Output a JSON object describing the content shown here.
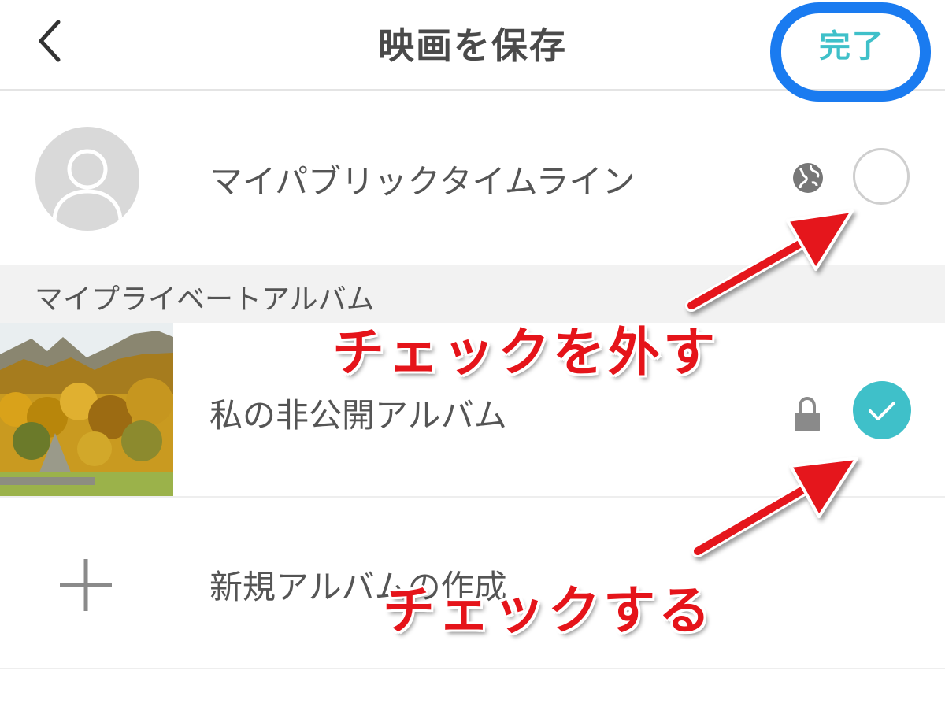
{
  "header": {
    "title": "映画を保存",
    "done_label": "完了",
    "back_icon": "chevron-left-icon"
  },
  "public_row": {
    "label": "マイパブリックタイムライン",
    "visibility_icon": "globe-icon",
    "selected": false
  },
  "section": {
    "title": "マイプライベートアルバム"
  },
  "private_row": {
    "label": "私の非公開アルバム",
    "visibility_icon": "lock-icon",
    "selected": true
  },
  "new_album": {
    "label": "新規アルバムの作成",
    "icon": "plus-icon"
  },
  "annotations": {
    "uncheck": "チェックを外す",
    "check": "チェックする"
  },
  "colors": {
    "accent": "#3fc0c9",
    "highlight_ring": "#1a7bf0",
    "annotation": "#e5141a"
  }
}
